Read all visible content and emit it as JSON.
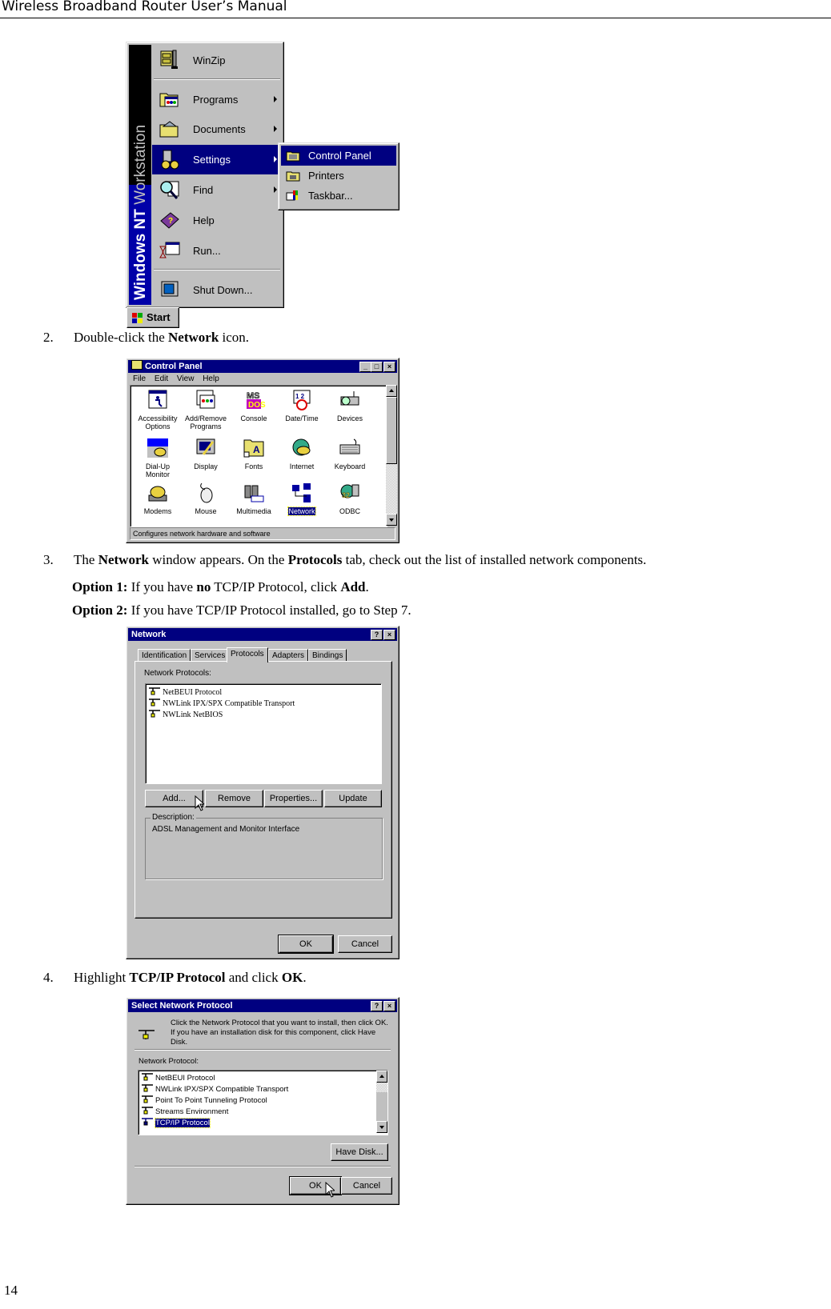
{
  "header": {
    "title": "Wireless Broadband Router User’s Manual"
  },
  "start_menu": {
    "band_text_bold": "Windows NT",
    "band_text_light": " Workstation",
    "items": [
      {
        "label": "WinZip",
        "icon": "winzip-icon",
        "submenu": false
      },
      {
        "label": "Programs",
        "icon": "programs-folder-icon",
        "submenu": true
      },
      {
        "label": "Documents",
        "icon": "documents-folder-icon",
        "submenu": true
      },
      {
        "label": "Settings",
        "icon": "settings-icon",
        "submenu": true,
        "selected": true
      },
      {
        "label": "Find",
        "icon": "find-magnifier-icon",
        "submenu": true
      },
      {
        "label": "Help",
        "icon": "help-book-icon",
        "submenu": false
      },
      {
        "label": "Run...",
        "icon": "run-icon",
        "submenu": false
      },
      {
        "label": "Shut Down...",
        "icon": "shutdown-computer-icon",
        "submenu": false
      }
    ],
    "settings_submenu": [
      {
        "label": "Control Panel",
        "icon": "control-panel-icon",
        "selected": true
      },
      {
        "label": "Printers",
        "icon": "printers-icon"
      },
      {
        "label": "Taskbar...",
        "icon": "taskbar-icon"
      }
    ],
    "start_button": "Start"
  },
  "steps": [
    {
      "num": "2.",
      "parts": [
        "Double-click the ",
        "Network",
        " icon."
      ]
    },
    {
      "num": "3.",
      "parts": [
        "The ",
        "Network",
        " window appears. On the ",
        "Protocols",
        " tab, check out the list of installed network components."
      ]
    },
    {
      "num": "4.",
      "parts": [
        "Highlight ",
        "TCP/IP Protocol",
        " and click ",
        "OK",
        "."
      ]
    }
  ],
  "options": [
    {
      "label": "Option 1:",
      "parts": [
        " If you have ",
        "no",
        " TCP/IP Protocol, click ",
        "Add",
        "."
      ]
    },
    {
      "label": "Option 2:",
      "parts": [
        " If you have TCP/IP Protocol installed, go to Step 7."
      ]
    }
  ],
  "control_panel": {
    "title": "Control Panel",
    "menu": [
      "File",
      "Edit",
      "View",
      "Help"
    ],
    "items": [
      {
        "label": "Accessibility Options"
      },
      {
        "label": "Add/Remove Programs"
      },
      {
        "label": "Console"
      },
      {
        "label": "Date/Time"
      },
      {
        "label": "Devices"
      },
      {
        "label": "Dial-Up Monitor"
      },
      {
        "label": "Display"
      },
      {
        "label": "Fonts"
      },
      {
        "label": "Internet"
      },
      {
        "label": "Keyboard"
      },
      {
        "label": "Modems"
      },
      {
        "label": "Mouse"
      },
      {
        "label": "Multimedia"
      },
      {
        "label": "Network",
        "selected": true
      },
      {
        "label": "ODBC"
      }
    ],
    "status": "Configures network hardware and software"
  },
  "network_dialog": {
    "title": "Network",
    "tabs": [
      "Identification",
      "Services",
      "Protocols",
      "Adapters",
      "Bindings"
    ],
    "active_tab": "Protocols",
    "list_label": "Network Protocols:",
    "protocols": [
      "NetBEUI Protocol",
      "NWLink IPX/SPX Compatible Transport",
      "NWLink NetBIOS"
    ],
    "buttons": {
      "add": "Add...",
      "remove": "Remove",
      "properties": "Properties...",
      "update": "Update"
    },
    "description_label": "Description:",
    "description": "ADSL Management and Monitor Interface",
    "ok": "OK",
    "cancel": "Cancel"
  },
  "select_protocol_dialog": {
    "title": "Select Network Protocol",
    "instructions": "Click the Network Protocol that you want to install, then click OK.  If you have an installation disk for this component, click Have Disk.",
    "list_label": "Network Protocol:",
    "protocols": [
      "NetBEUI Protocol",
      "NWLink IPX/SPX Compatible Transport",
      "Point To Point Tunneling Protocol",
      "Streams Environment",
      "TCP/IP Protocol"
    ],
    "selected_index": 4,
    "have_disk": "Have Disk...",
    "ok": "OK",
    "cancel": "Cancel"
  },
  "page_number": "14"
}
